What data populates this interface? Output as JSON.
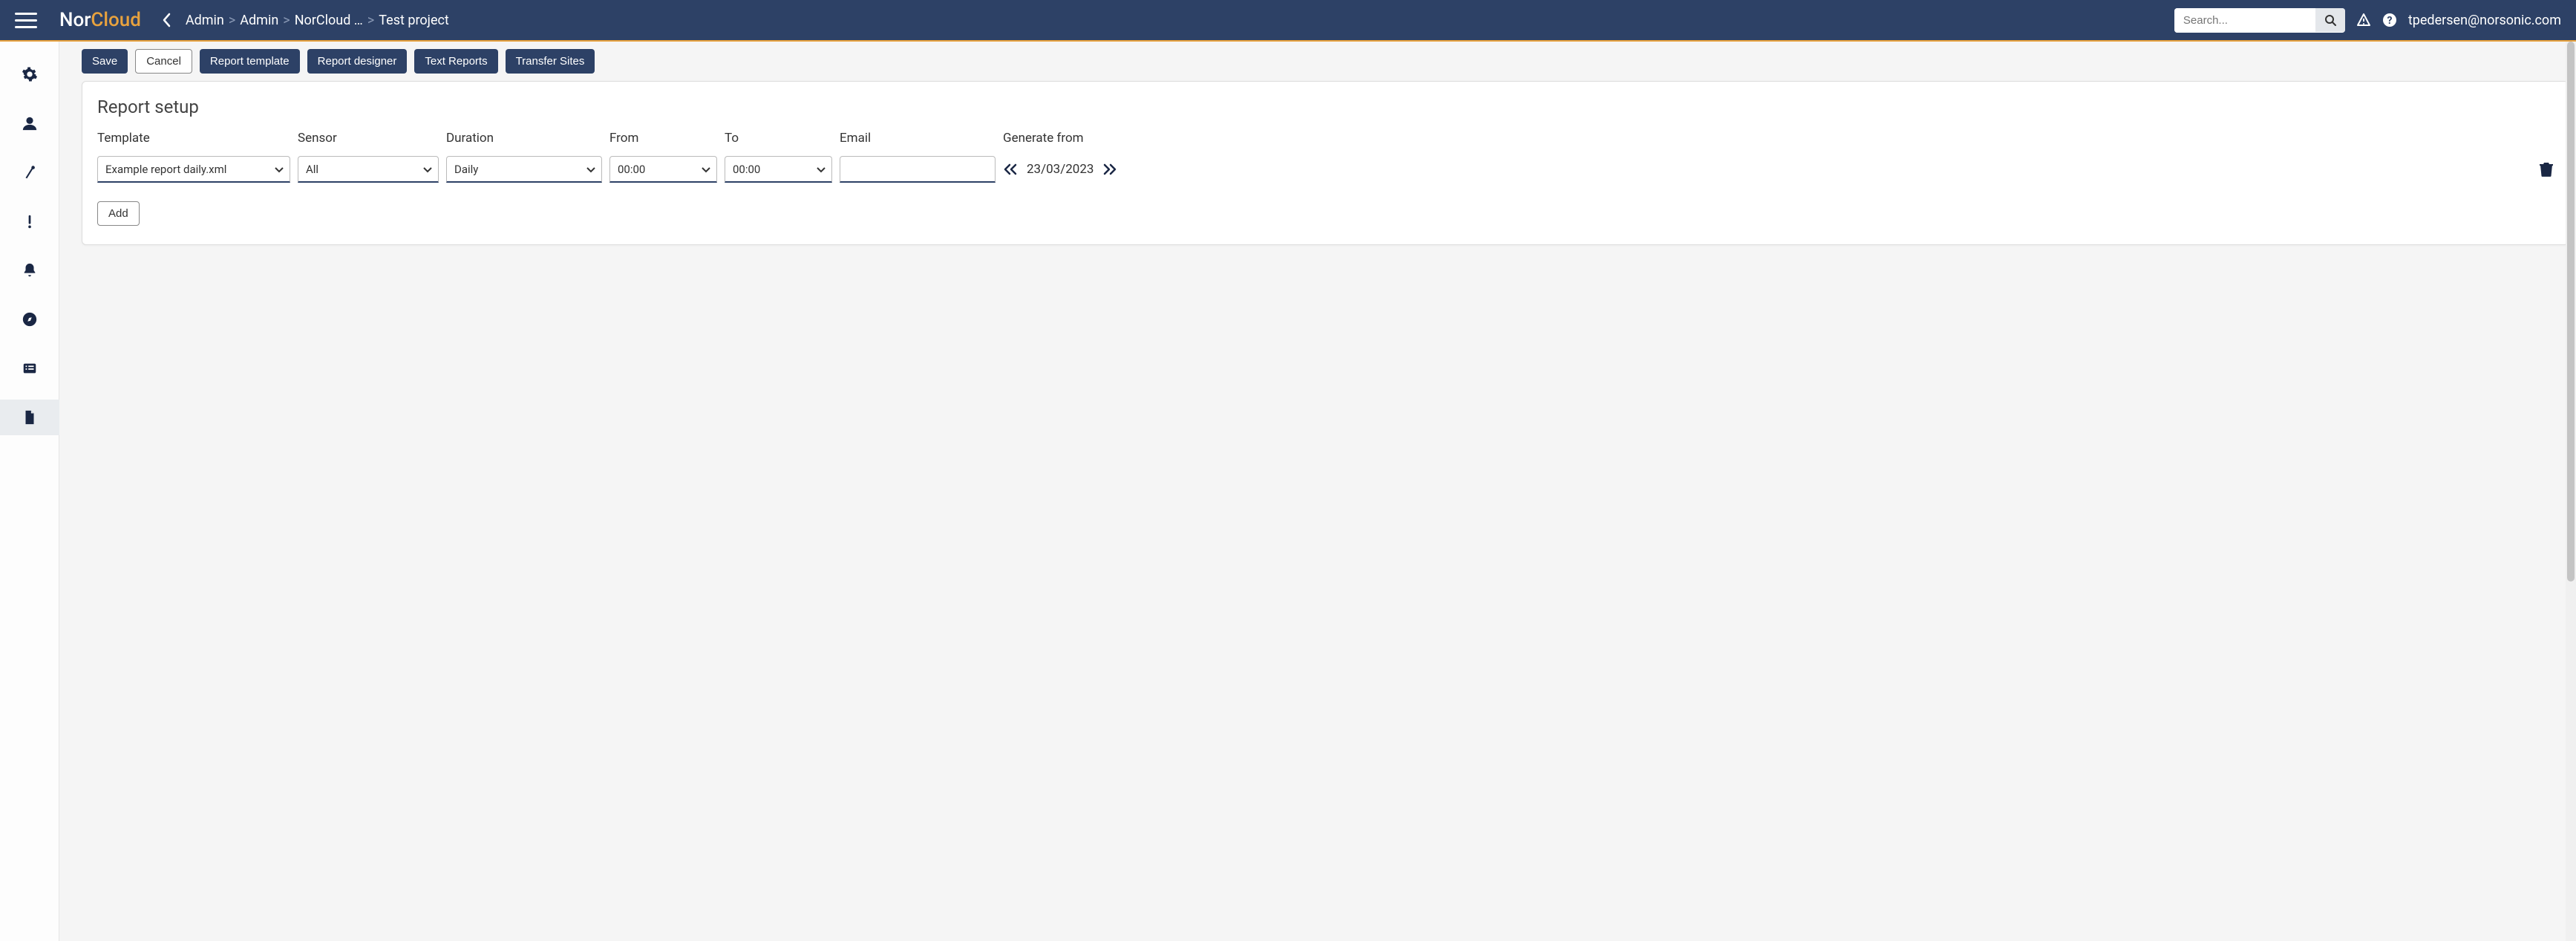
{
  "brand": {
    "nor": "Nor",
    "cloud": "Cloud"
  },
  "breadcrumb": {
    "items": [
      "Admin",
      "Admin",
      "NorCloud …",
      "Test project"
    ]
  },
  "search": {
    "placeholder": "Search..."
  },
  "user": {
    "email": "tpedersen@norsonic.com"
  },
  "toolbar": {
    "save": "Save",
    "cancel": "Cancel",
    "report_template": "Report template",
    "report_designer": "Report designer",
    "text_reports": "Text Reports",
    "transfer_sites": "Transfer Sites"
  },
  "card": {
    "title": "Report setup",
    "headers": {
      "template": "Template",
      "sensor": "Sensor",
      "duration": "Duration",
      "from": "From",
      "to": "To",
      "email": "Email",
      "generate_from": "Generate from"
    },
    "row": {
      "template": "Example report daily.xml",
      "sensor": "All",
      "duration": "Daily",
      "from": "00:00",
      "to": "00:00",
      "email": "",
      "generate_from": "23/03/2023"
    },
    "add": "Add"
  }
}
